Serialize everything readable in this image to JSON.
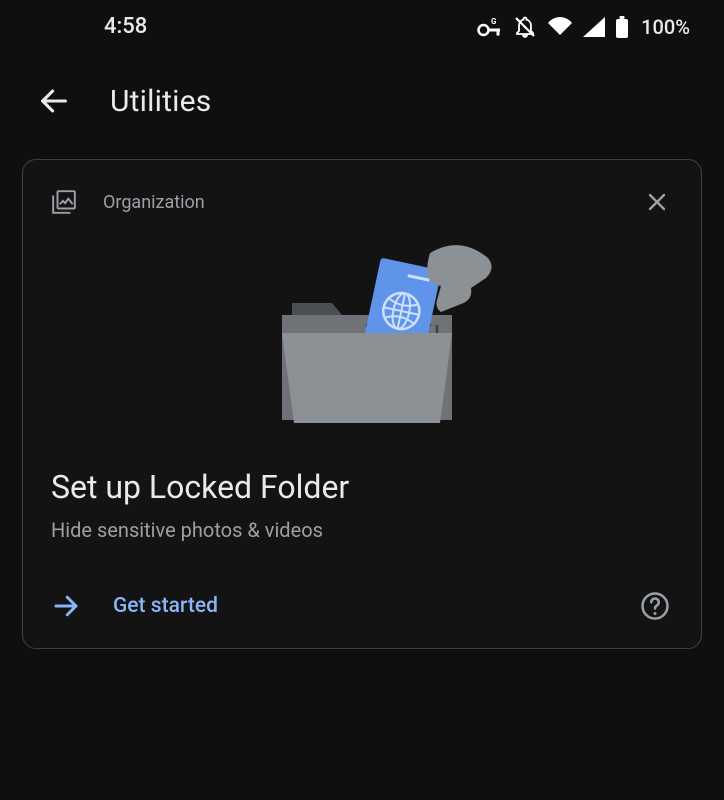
{
  "status": {
    "time": "4:58",
    "battery": "100%"
  },
  "appbar": {
    "title": "Utilities"
  },
  "card": {
    "category": "Organization",
    "title": "Set up Locked Folder",
    "subtitle": "Hide sensitive photos & videos",
    "action_label": "Get started"
  }
}
